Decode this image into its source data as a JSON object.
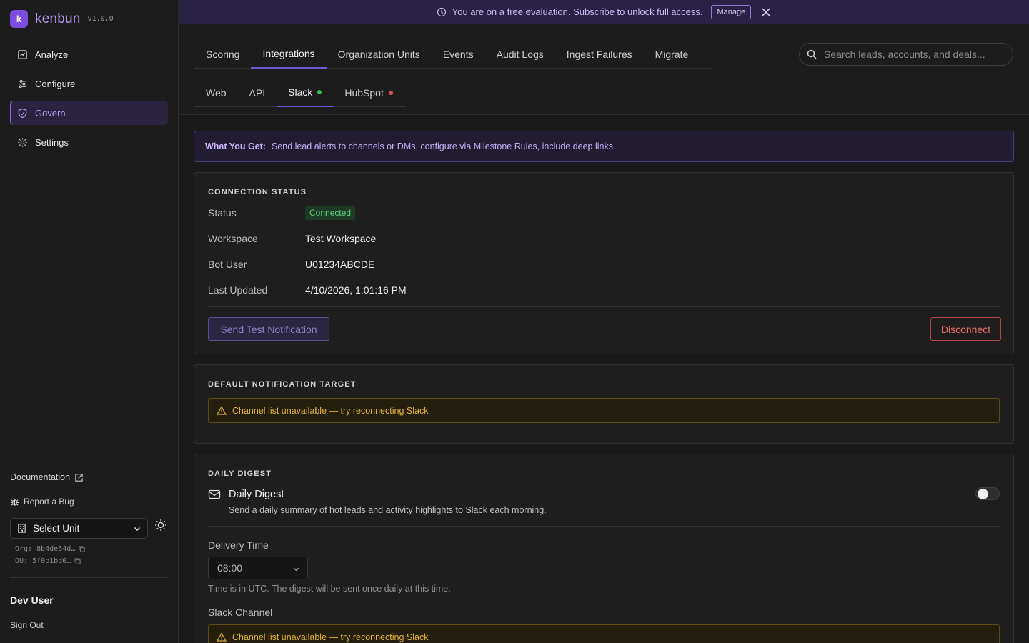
{
  "app": {
    "name": "kenbun",
    "version": "v1.0.0",
    "logo_letter": "k"
  },
  "sidebar": {
    "items": [
      {
        "label": "Analyze",
        "icon": "chart-square-icon"
      },
      {
        "label": "Configure",
        "icon": "sliders-icon"
      },
      {
        "label": "Govern",
        "icon": "shield-check-icon",
        "active": true
      },
      {
        "label": "Settings",
        "icon": "gear-icon"
      }
    ],
    "documentation_label": "Documentation",
    "report_bug_label": "Report a Bug",
    "unit_select": {
      "value": "Select Unit"
    },
    "org_id": "Org: 8b4de64d…",
    "ou_id": "OU: 5f0b1bd0…",
    "user_name": "Dev User",
    "sign_out_label": "Sign Out"
  },
  "banner": {
    "message": "You are on a free evaluation. Subscribe to unlock full access.",
    "manage_label": "Manage"
  },
  "header": {
    "tabs": [
      "Scoring",
      "Integrations",
      "Organization Units",
      "Events",
      "Audit Logs",
      "Ingest Failures",
      "Migrate"
    ],
    "active_tab": "Integrations",
    "subtabs": [
      {
        "label": "Web"
      },
      {
        "label": "API"
      },
      {
        "label": "Slack",
        "status_color": "#3fb950",
        "active": true
      },
      {
        "label": "HubSpot",
        "status_color": "#e5484d"
      }
    ],
    "search_placeholder": "Search leads, accounts, and deals..."
  },
  "info": {
    "title": "What You Get:",
    "text": "Send lead alerts to channels or DMs, configure via Milestone Rules, include deep links"
  },
  "connection": {
    "title": "CONNECTION STATUS",
    "status_label": "Status",
    "status_value": "Connected",
    "workspace_label": "Workspace",
    "workspace_value": "Test Workspace",
    "bot_label": "Bot User",
    "bot_value": "U01234ABCDE",
    "updated_label": "Last Updated",
    "updated_value": "4/10/2026, 1:01:16 PM",
    "test_button": "Send Test Notification",
    "disconnect_button": "Disconnect"
  },
  "default_target": {
    "title": "DEFAULT NOTIFICATION TARGET",
    "warning": "Channel list unavailable — try reconnecting Slack"
  },
  "digest": {
    "title": "DAILY DIGEST",
    "name": "Daily Digest",
    "description": "Send a daily summary of hot leads and activity highlights to Slack each morning.",
    "enabled": false,
    "delivery_label": "Delivery Time",
    "delivery_value": "08:00",
    "hint": "Time is in UTC. The digest will be sent once daily at this time.",
    "channel_label": "Slack Channel",
    "channel_warning": "Channel list unavailable — try reconnecting Slack"
  },
  "colors": {
    "accent": "#7c4dde",
    "connected": "#5fd07a",
    "danger": "#ef6b6b",
    "warning": "#e0b23a"
  }
}
